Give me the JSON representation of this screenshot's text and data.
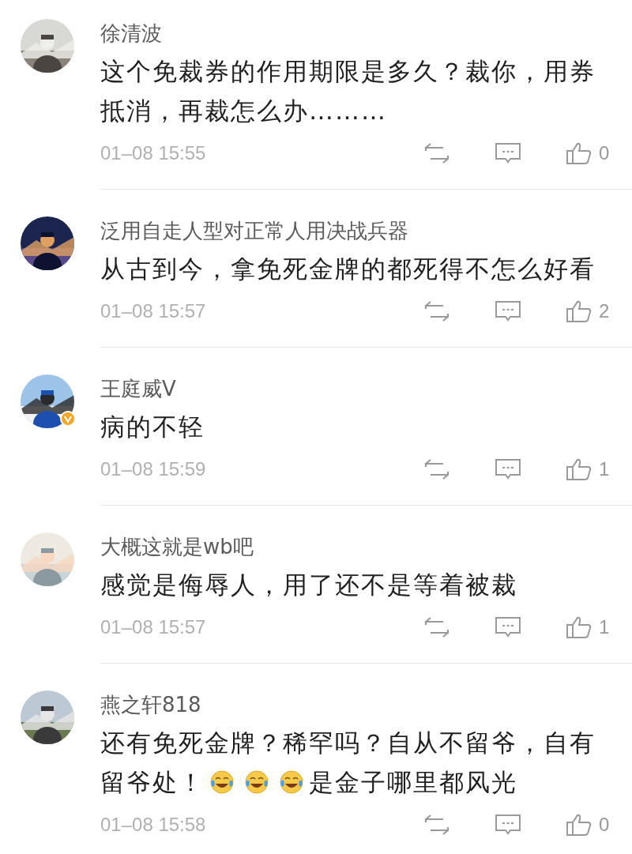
{
  "comments": [
    {
      "author": "徐清波",
      "verified": false,
      "segments": [
        {
          "kind": "text",
          "text": "这个免裁券的作用期限是多久？裁你，用券抵消，再裁怎么办………"
        }
      ],
      "time": "01–08 15:55",
      "likes": "0"
    },
    {
      "author": "泛用自走人型对正常人用决战兵器",
      "verified": false,
      "segments": [
        {
          "kind": "text",
          "text": "从古到今，拿免死金牌的都死得不怎么好看"
        }
      ],
      "time": "01–08 15:57",
      "likes": "2"
    },
    {
      "author": "王庭威V",
      "verified": true,
      "segments": [
        {
          "kind": "text",
          "text": "病的不轻"
        }
      ],
      "time": "01–08 15:59",
      "likes": "1"
    },
    {
      "author": "大概这就是wb吧",
      "verified": false,
      "segments": [
        {
          "kind": "text",
          "text": "感觉是侮辱人，用了还不是等着被裁"
        }
      ],
      "time": "01–08 15:57",
      "likes": "1"
    },
    {
      "author": "燕之轩818",
      "verified": false,
      "segments": [
        {
          "kind": "text",
          "text": "还有免死金牌？稀罕吗？自从不留爷，自有留爷处！"
        },
        {
          "kind": "emoji"
        },
        {
          "kind": "emoji"
        },
        {
          "kind": "emoji"
        },
        {
          "kind": "text",
          "text": "是金子哪里都风光"
        }
      ],
      "time": "01–08 15:58",
      "likes": "0"
    }
  ]
}
